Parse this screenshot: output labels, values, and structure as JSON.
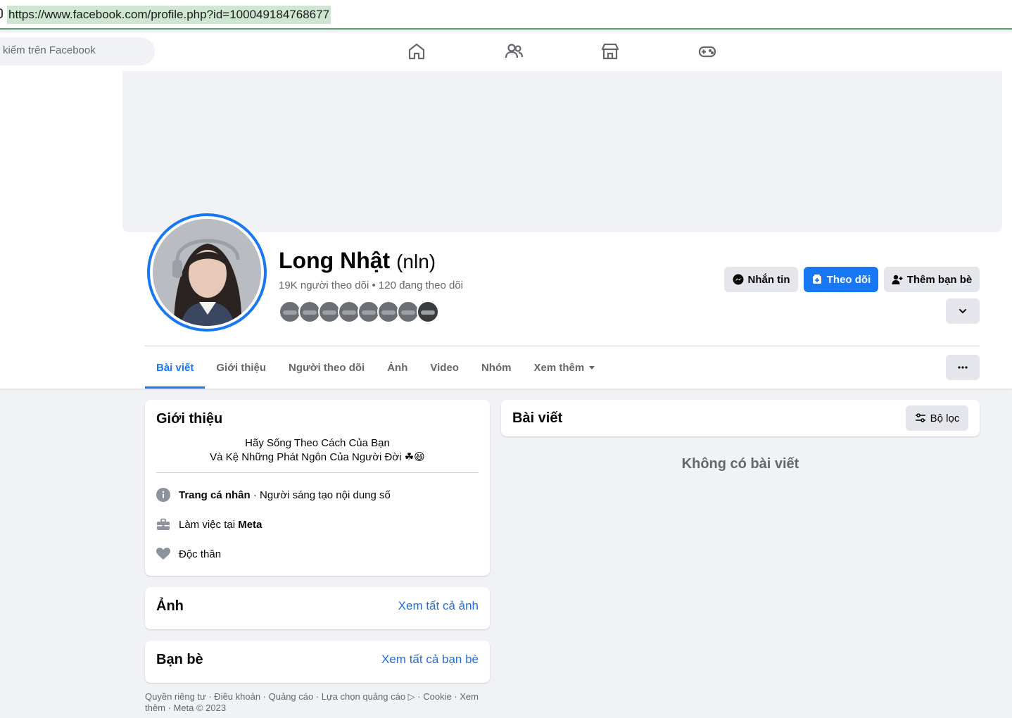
{
  "browser": {
    "url": "https://www.facebook.com/profile.php?id=100049184768677"
  },
  "topnav": {
    "search_placeholder": "kiếm trên Facebook",
    "icons": [
      "home-icon",
      "friends-icon",
      "marketplace-icon",
      "gaming-icon"
    ]
  },
  "profile": {
    "name": "Long Nhật",
    "alt_name": "(nln)",
    "followers": "19K người theo dõi • 120 đang theo dõi",
    "follower_avatar_count": 8
  },
  "actions": {
    "message": "Nhắn tin",
    "follow": "Theo dõi",
    "add_friend": "Thêm bạn bè"
  },
  "tabs": [
    {
      "label": "Bài viết",
      "active": true
    },
    {
      "label": "Giới thiệu",
      "active": false
    },
    {
      "label": "Người theo dõi",
      "active": false
    },
    {
      "label": "Ảnh",
      "active": false
    },
    {
      "label": "Video",
      "active": false
    },
    {
      "label": "Nhóm",
      "active": false
    },
    {
      "label": "Xem thêm",
      "active": false
    }
  ],
  "intro": {
    "title": "Giới thiệu",
    "bio_line1": "Hãy Sống Theo Cách Của Bạn",
    "bio_line2": "Và Kệ Những Phát Ngôn Của Người Đời ☘😆",
    "rows": [
      {
        "bold": "Trang cá nhân",
        "text": " · Người sáng tạo nội dung số"
      },
      {
        "prefix": "Làm việc tại ",
        "bold": "Meta"
      },
      {
        "text": "Độc thân"
      }
    ]
  },
  "photos": {
    "title": "Ảnh",
    "link": "Xem tất cả ảnh"
  },
  "friends": {
    "title": "Bạn bè",
    "link": "Xem tất cả bạn bè"
  },
  "posts": {
    "title": "Bài viết",
    "filter": "Bộ lọc",
    "empty": "Không có bài viết"
  },
  "footer": {
    "text": "Quyền riêng tư · Điều khoản · Quảng cáo · Lựa chọn quảng cáo ▷ · Cookie · Xem thêm · Meta © 2023"
  },
  "colors": {
    "accent": "#1877f2",
    "link": "#216fdb",
    "background": "#f0f2f5",
    "secondary_text": "#65676b"
  }
}
